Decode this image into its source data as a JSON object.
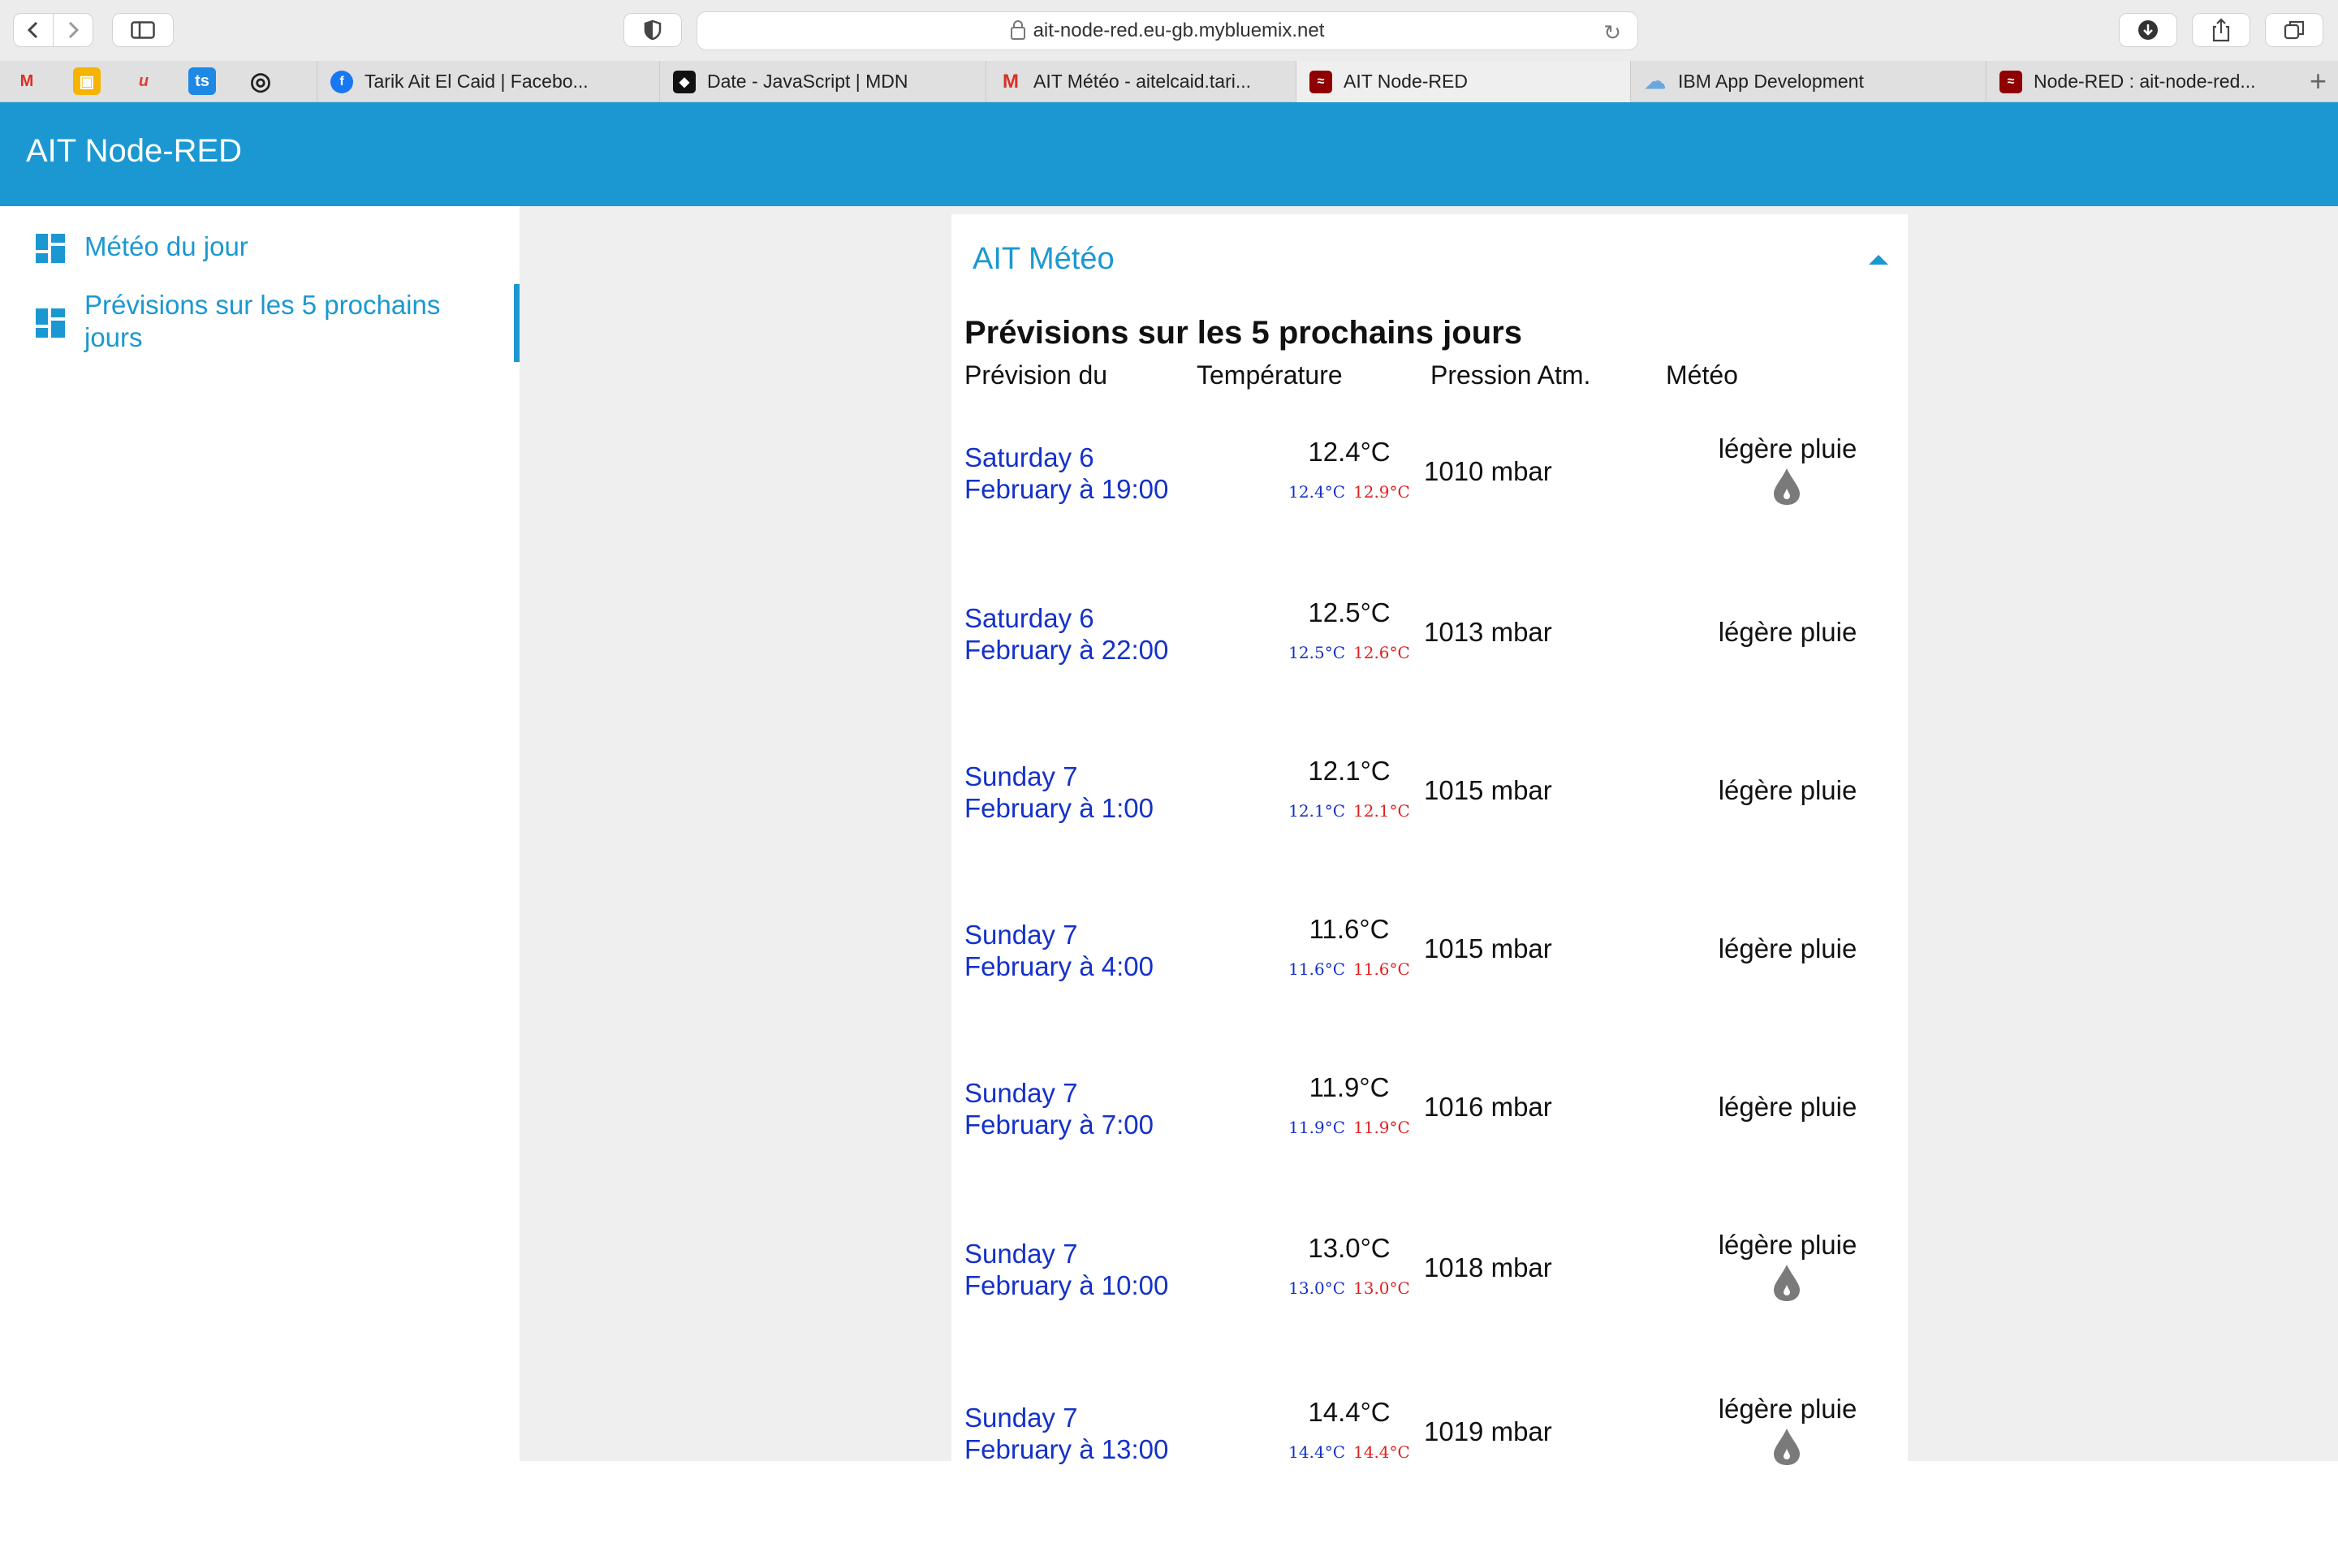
{
  "browser": {
    "url": "ait-node-red.eu-gb.mybluemix.net",
    "pinned_tabs": [
      {
        "name": "gmail-icon",
        "glyph": "M",
        "color": "#d93025"
      },
      {
        "name": "classroom-icon",
        "glyph": "▣",
        "color": "#f4b400"
      },
      {
        "name": "u-app-icon",
        "glyph": "u",
        "color": "#e53935"
      },
      {
        "name": "ts-icon",
        "glyph": "ts",
        "color": "#1e88e5"
      },
      {
        "name": "instagram-icon",
        "glyph": "◎",
        "color": "#222222"
      }
    ],
    "tabs": [
      {
        "label": "Tarik Ait El Caid | Facebo...",
        "icon": "facebook-icon",
        "color": "#1877f2",
        "glyph": "f"
      },
      {
        "label": "Date - JavaScript | MDN",
        "icon": "mdn-icon",
        "color": "#111111",
        "glyph": "◆"
      },
      {
        "label": "AIT Météo - aitelcaid.tari...",
        "icon": "gmail-icon",
        "color": "#d93025",
        "glyph": "M"
      },
      {
        "label": "AIT Node-RED",
        "icon": "node-red-icon",
        "color": "#8f0000",
        "glyph": "≈"
      },
      {
        "label": "IBM App Development",
        "icon": "ibm-cloud-icon",
        "color": "#9cc8ee",
        "glyph": "☁"
      },
      {
        "label": "Node-RED : ait-node-red...",
        "icon": "node-red-icon",
        "color": "#8f0000",
        "glyph": "≈"
      }
    ]
  },
  "header": {
    "title": "AIT Node-RED"
  },
  "sidebar": {
    "items": [
      {
        "label": "Météo du jour",
        "icon": "dashboard-icon"
      },
      {
        "label": "Prévisions sur les 5 prochains jours",
        "icon": "dashboard-icon",
        "active": true
      }
    ]
  },
  "card": {
    "title": "AIT Météo",
    "section_title": "Prévisions sur les 5 prochains jours",
    "columns": [
      "Prévision du",
      "Température",
      "Pression Atm.",
      "Météo"
    ]
  },
  "colors": {
    "accent": "#1b98d2",
    "date_blue": "#1431c9",
    "max_red": "#e02020"
  },
  "forecast": [
    {
      "date_line1": "Saturday 6",
      "date_line2": "February à 19:00",
      "temp": "12.4°C",
      "min": "12.4°C",
      "max": "12.9°C",
      "pressure": "1010 mbar",
      "meteo": "légère pluie",
      "icon": "rain-drop-icon",
      "show_icon": true
    },
    {
      "date_line1": "Saturday 6",
      "date_line2": "February à 22:00",
      "temp": "12.5°C",
      "min": "12.5°C",
      "max": "12.6°C",
      "pressure": "1013 mbar",
      "meteo": "légère pluie",
      "show_icon": false
    },
    {
      "date_line1": "Sunday 7",
      "date_line2": "February à 1:00",
      "temp": "12.1°C",
      "min": "12.1°C",
      "max": "12.1°C",
      "pressure": "1015 mbar",
      "meteo": "légère pluie",
      "show_icon": false
    },
    {
      "date_line1": "Sunday 7",
      "date_line2": "February à 4:00",
      "temp": "11.6°C",
      "min": "11.6°C",
      "max": "11.6°C",
      "pressure": "1015 mbar",
      "meteo": "légère pluie",
      "show_icon": false
    },
    {
      "date_line1": "Sunday 7",
      "date_line2": "February à 7:00",
      "temp": "11.9°C",
      "min": "11.9°C",
      "max": "11.9°C",
      "pressure": "1016 mbar",
      "meteo": "légère pluie",
      "show_icon": false
    },
    {
      "date_line1": "Sunday 7",
      "date_line2": "February à 10:00",
      "temp": "13.0°C",
      "min": "13.0°C",
      "max": "13.0°C",
      "pressure": "1018 mbar",
      "meteo": "légère pluie",
      "icon": "rain-drop-icon",
      "show_icon": true
    },
    {
      "date_line1": "Sunday 7",
      "date_line2": "February à 13:00",
      "temp": "14.4°C",
      "min": "14.4°C",
      "max": "14.4°C",
      "pressure": "1019 mbar",
      "meteo": "légère pluie",
      "icon": "rain-drop-icon",
      "show_icon": true
    }
  ]
}
